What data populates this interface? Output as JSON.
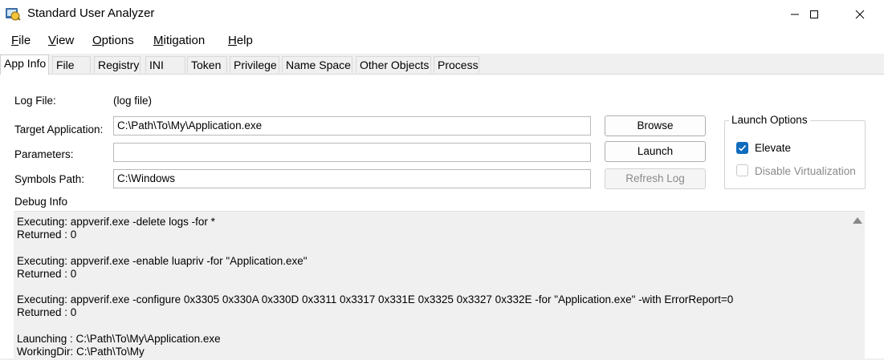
{
  "window": {
    "title": "Standard User Analyzer"
  },
  "menu": {
    "file": {
      "u": "F",
      "rest": "ile"
    },
    "view": {
      "u": "V",
      "rest": "iew"
    },
    "options": {
      "u": "O",
      "rest": "ptions"
    },
    "mitigation": {
      "u": "M",
      "rest": "itigation"
    },
    "help": {
      "u": "H",
      "rest": "elp"
    }
  },
  "tabs": [
    "App Info",
    "File",
    "Registry",
    "INI",
    "Token",
    "Privilege",
    "Name Space",
    "Other Objects",
    "Process"
  ],
  "app_info": {
    "log_file_label": "Log File:",
    "log_file_value": "(log file)",
    "target_label": "Target Application:",
    "target_value": "C:\\Path\\To\\My\\Application.exe",
    "parameters_label": "Parameters:",
    "parameters_value": "",
    "symbols_label": "Symbols Path:",
    "symbols_value": "C:\\Windows",
    "browse_label": "Browse",
    "launch_label": "Launch",
    "refresh_label": "Refresh Log",
    "debug_label": "Debug Info"
  },
  "launch_options": {
    "title": "Launch Options",
    "elevate_label": "Elevate",
    "elevate_checked": true,
    "disable_virt_label": "Disable Virtualization",
    "disable_virt_checked": false
  },
  "debug_lines": [
    "Executing: appverif.exe -delete logs -for *",
    "Returned : 0",
    "",
    "Executing: appverif.exe -enable luapriv -for \"Application.exe\"",
    "Returned : 0",
    "",
    "Executing: appverif.exe -configure 0x3305 0x330A 0x330D 0x3311 0x3317 0x331E 0x3325 0x3327 0x332E -for \"Application.exe\" -with ErrorReport=0",
    "Returned : 0",
    "",
    "Launching : C:\\Path\\To\\My\\Application.exe",
    "WorkingDir: C:\\Path\\To\\My"
  ],
  "icons": {
    "app": "sua-app-icon",
    "minimize": "minimize-icon",
    "maximize": "maximize-icon",
    "close": "close-icon",
    "check": "checkmark-icon",
    "scroll_up": "scroll-up-arrow-icon"
  },
  "colors": {
    "accent": "#0f6cbd"
  }
}
